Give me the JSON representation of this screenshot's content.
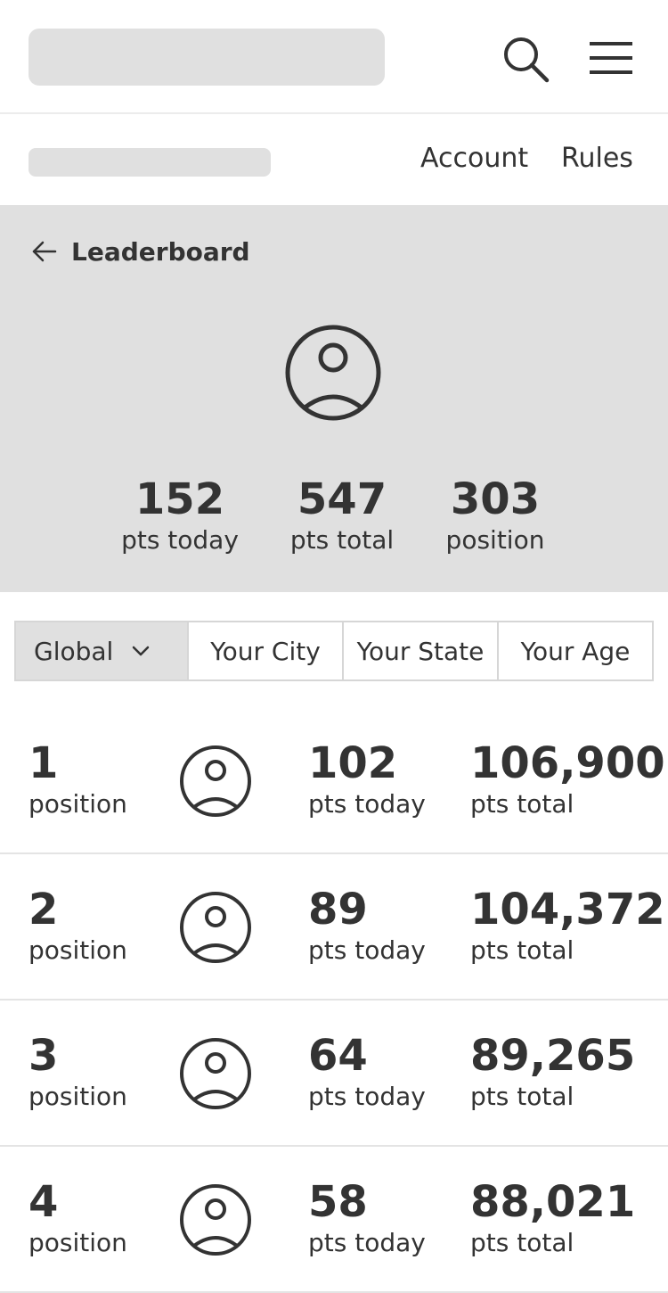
{
  "header": {
    "search_icon": "search-icon",
    "menu_icon": "hamburger-menu-icon"
  },
  "subnav": {
    "links": [
      "Account",
      "Rules"
    ]
  },
  "hero": {
    "back_icon": "arrow-left-icon",
    "title": "Leaderboard",
    "avatar_icon": "user-circle-icon",
    "stats": [
      {
        "value": "152",
        "label": "pts today"
      },
      {
        "value": "547",
        "label": "pts total"
      },
      {
        "value": "303",
        "label": "position"
      }
    ]
  },
  "filters": {
    "selected": "Global",
    "selected_icon": "chevron-down-icon",
    "options": [
      "Your City",
      "Your State",
      "Your Age"
    ]
  },
  "leaderboard": [
    {
      "position": "1",
      "position_label": "position",
      "today": "102",
      "today_label": "pts today",
      "total": "106,900",
      "total_label": "pts total"
    },
    {
      "position": "2",
      "position_label": "position",
      "today": "89",
      "today_label": "pts today",
      "total": "104,372",
      "total_label": "pts total"
    },
    {
      "position": "3",
      "position_label": "position",
      "today": "64",
      "today_label": "pts today",
      "total": "89,265",
      "total_label": "pts total"
    },
    {
      "position": "4",
      "position_label": "position",
      "today": "58",
      "today_label": "pts today",
      "total": "88,021",
      "total_label": "pts total"
    }
  ],
  "colors": {
    "text": "#333333",
    "placeholder": "#e0e0e0",
    "hero_bg": "#e0e0e0",
    "border": "#d6d6d6"
  }
}
